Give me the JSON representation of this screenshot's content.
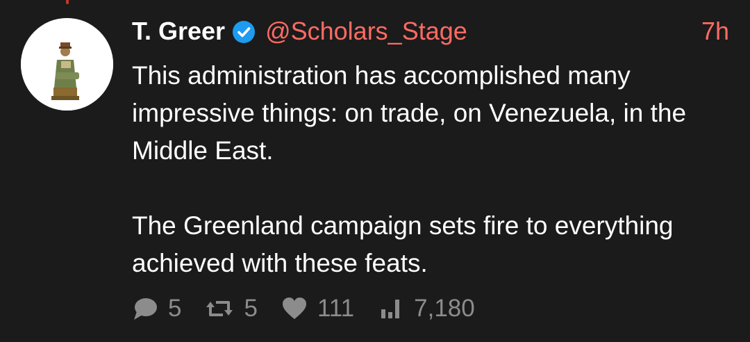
{
  "tweet": {
    "author_name": "T. Greer",
    "handle": "@Scholars_Stage",
    "time": "7h",
    "paragraphs": [
      "This administration has accomplished many impressive things: on trade, on Venezuela, in the Middle East.",
      "The Greenland campaign sets fire to everything achieved with these feats."
    ],
    "verified": true
  },
  "actions": {
    "replies": "5",
    "retweets": "5",
    "likes": "111",
    "views": "7,180"
  },
  "icons": {
    "verified": "verified-badge-icon",
    "reply": "comment-bubble-icon",
    "retweet": "retweet-icon",
    "like": "heart-icon",
    "views": "bar-chart-icon"
  },
  "colors": {
    "background": "#1b1b1b",
    "text": "#ffffff",
    "accent": "#ff6b63",
    "muted": "#8c8c8c",
    "verified": "#1d9bf0"
  }
}
